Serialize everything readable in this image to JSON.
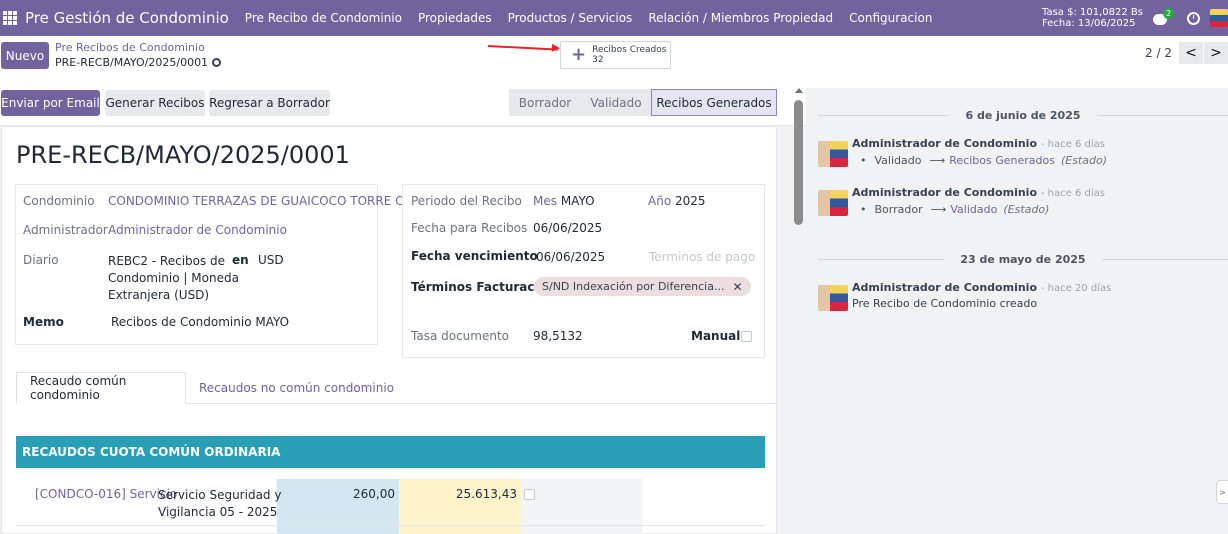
{
  "navbar": {
    "brand": "Pre Gestión de Condominio",
    "menu": [
      "Pre Recibo de Condominio",
      "Propiedades",
      "Productos / Servicios",
      "Relación / Miembros Propiedad",
      "Configuracion"
    ],
    "rate_line": "Tasa $: 101,0822 Bs",
    "date_line": "Fecha: 13/06/2025",
    "messages_count": "2",
    "icons": [
      "apps-icon",
      "chat-icon",
      "clock-icon",
      "avatar"
    ]
  },
  "control": {
    "new_label": "Nuevo",
    "breadcrumb_parent": "Pre Recibos de Condominio",
    "breadcrumb_current": "PRE-RECB/MAYO/2025/0001",
    "smart_label": "Recibos Creados",
    "smart_count": "32",
    "pager_value": "2 / 2",
    "pager_prev": "<",
    "pager_next": ">"
  },
  "actions": {
    "send_email": "Enviar por Email",
    "generate": "Generar Recibos",
    "back_draft": "Regresar a Borrador"
  },
  "status": {
    "draft": "Borrador",
    "validated": "Validado",
    "generated": "Recibos Generados",
    "active": "Recibos Generados"
  },
  "form": {
    "title": "PRE-RECB/MAYO/2025/0001",
    "left": {
      "condo_label": "Condominio",
      "condo_value": "CONDOMINIO TERRAZAS DE GUAICOCO TORRE C",
      "admin_label": "Administrador",
      "admin_value": "Administrador de Condominio",
      "journal_label": "Diario",
      "journal_value_1": "REBC2 - Recibos de",
      "journal_value_2": "Condominio | Moneda",
      "journal_value_3": "Extranjera (USD)",
      "currency_label": "en",
      "currency_value": "USD",
      "memo_label": "Memo",
      "memo_value": "Recibos de Condominio  MAYO"
    },
    "right": {
      "period_label": "Periodo del Recibo",
      "month_label": "Mes",
      "month_value": "MAYO",
      "year_label": "Año",
      "year_value": "2025",
      "receipt_date_label": "Fecha para Recibos",
      "receipt_date_value": "06/06/2025",
      "due_date_label": "Fecha vencimiento",
      "due_date_value": "06/06/2025",
      "payment_terms_placeholder": "Terminos de pago",
      "billing_terms_label": "Términos Facturación",
      "billing_terms_tag": "S/ND Indexación por Diferencia...",
      "doc_rate_label": "Tasa documento",
      "doc_rate_value": "98,5132",
      "manual_label": "Manual"
    },
    "tabs": [
      "Recaudo común condominio",
      "Recaudos no común condominio"
    ],
    "section_title": "RECAUDOS CUOTA COMÚN ORDINARIA",
    "lines": [
      {
        "code": "[CONDCO-016] Servicio",
        "description_1": "Servicio Seguridad y",
        "description_2": "Vigilancia 05 - 2025",
        "amount_usd": "260,00",
        "amount_bs": "25.613,43"
      }
    ]
  },
  "chatter": {
    "groups": [
      {
        "date": "6 de junio de 2025",
        "messages": [
          {
            "author": "Administrador de Condominio",
            "time": "- hace 6 días",
            "old": "Validado",
            "new": "Recibos Generados",
            "field": "(Estado)"
          },
          {
            "author": "Administrador de Condominio",
            "time": "- hace 6 días",
            "old": "Borrador",
            "new": "Validado",
            "field": "(Estado)"
          }
        ]
      },
      {
        "date": "23 de mayo de 2025",
        "messages": [
          {
            "author": "Administrador de Condominio",
            "time": "- hace 20 días",
            "body": "Pre Recibo de Condominio creado"
          }
        ]
      }
    ]
  },
  "colors": {
    "brand": "#71639e",
    "section": "#289fb4",
    "col_blue": "#d2e7ef",
    "col_yellow": "#fdf4cc",
    "annotation_arrow": "#e3262a"
  }
}
